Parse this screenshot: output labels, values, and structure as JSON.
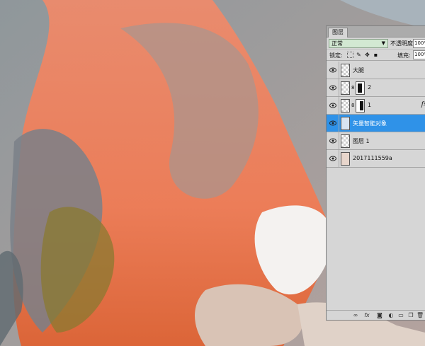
{
  "panel": {
    "tab_label": "图层",
    "blend_mode": "正常",
    "opacity_label": "不透明度:",
    "opacity_value": "100%",
    "lock_label": "锁定:",
    "fill_label": "填充:",
    "fill_value": "100%"
  },
  "layers": [
    {
      "name": "大腿",
      "visible": true,
      "has_mask": false,
      "has_fx": false,
      "selected": false
    },
    {
      "name": "2",
      "visible": true,
      "has_mask": true,
      "has_fx": false,
      "selected": false
    },
    {
      "name": "1",
      "visible": true,
      "has_mask": true,
      "has_fx": true,
      "selected": false
    },
    {
      "name": "矢量智能对象",
      "visible": true,
      "has_mask": false,
      "has_fx": false,
      "selected": true
    },
    {
      "name": "图层 1",
      "visible": true,
      "has_mask": false,
      "has_fx": false,
      "selected": false
    },
    {
      "name": "2017111559a",
      "visible": true,
      "has_mask": false,
      "has_fx": false,
      "selected": false
    }
  ],
  "fx_symbol": "fx",
  "colors": {
    "selected_layer": "#2f92e8",
    "blend_field": "#d2e8d2",
    "panel_bg": "#d6d6d6"
  }
}
